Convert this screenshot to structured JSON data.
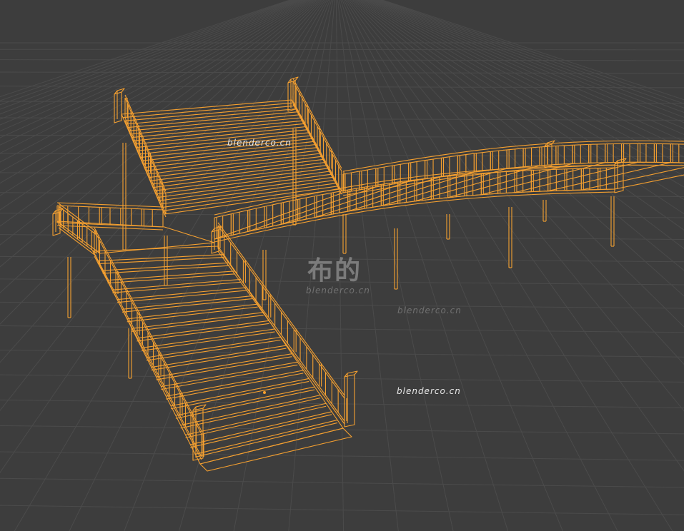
{
  "viewport": {
    "background": "#3d3d3d",
    "grid_color": "#4a4a4a",
    "wire_color": "#f5a030",
    "selected_object": "bridge-staircase-wireframe",
    "origin_marker": "object-origin-dot"
  },
  "watermarks": {
    "top": "blenderco.cn",
    "bottom_right": "blenderco.cn",
    "logo_text": "布的",
    "logo_sub": "blenderco.cn",
    "faint_right": "blenderco.cn"
  }
}
